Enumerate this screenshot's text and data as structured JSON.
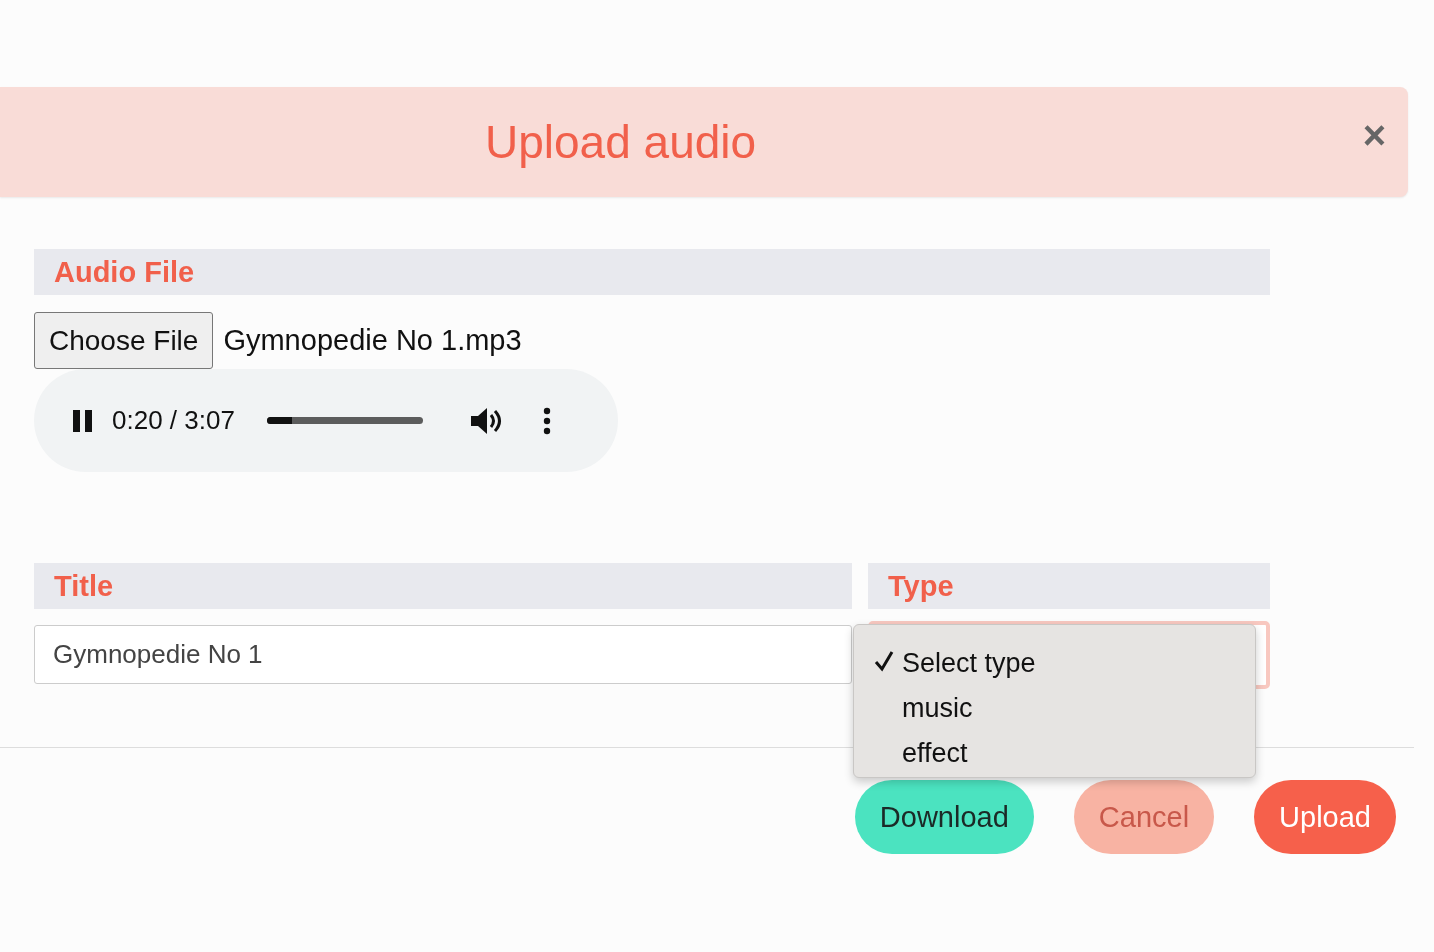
{
  "dialog": {
    "title": "Upload audio",
    "close": "×"
  },
  "audio_file": {
    "label": "Audio File",
    "choose_button": "Choose File",
    "file_name": "Gymnopedie No 1.mp3",
    "player": {
      "playing": true,
      "time": "0:20 / 3:07",
      "level": 0.16
    }
  },
  "title_field": {
    "label": "Title",
    "value": "Gymnopedie No 1"
  },
  "type_field": {
    "label": "Type",
    "options": [
      {
        "label": "Select type",
        "selected": true
      },
      {
        "label": "music",
        "selected": false
      },
      {
        "label": "effect",
        "selected": false
      }
    ]
  },
  "buttons": [
    {
      "label": "Download",
      "kind": "download"
    },
    {
      "label": "Cancel",
      "kind": "cancel"
    },
    {
      "label": "Upload",
      "kind": "upload"
    }
  ]
}
